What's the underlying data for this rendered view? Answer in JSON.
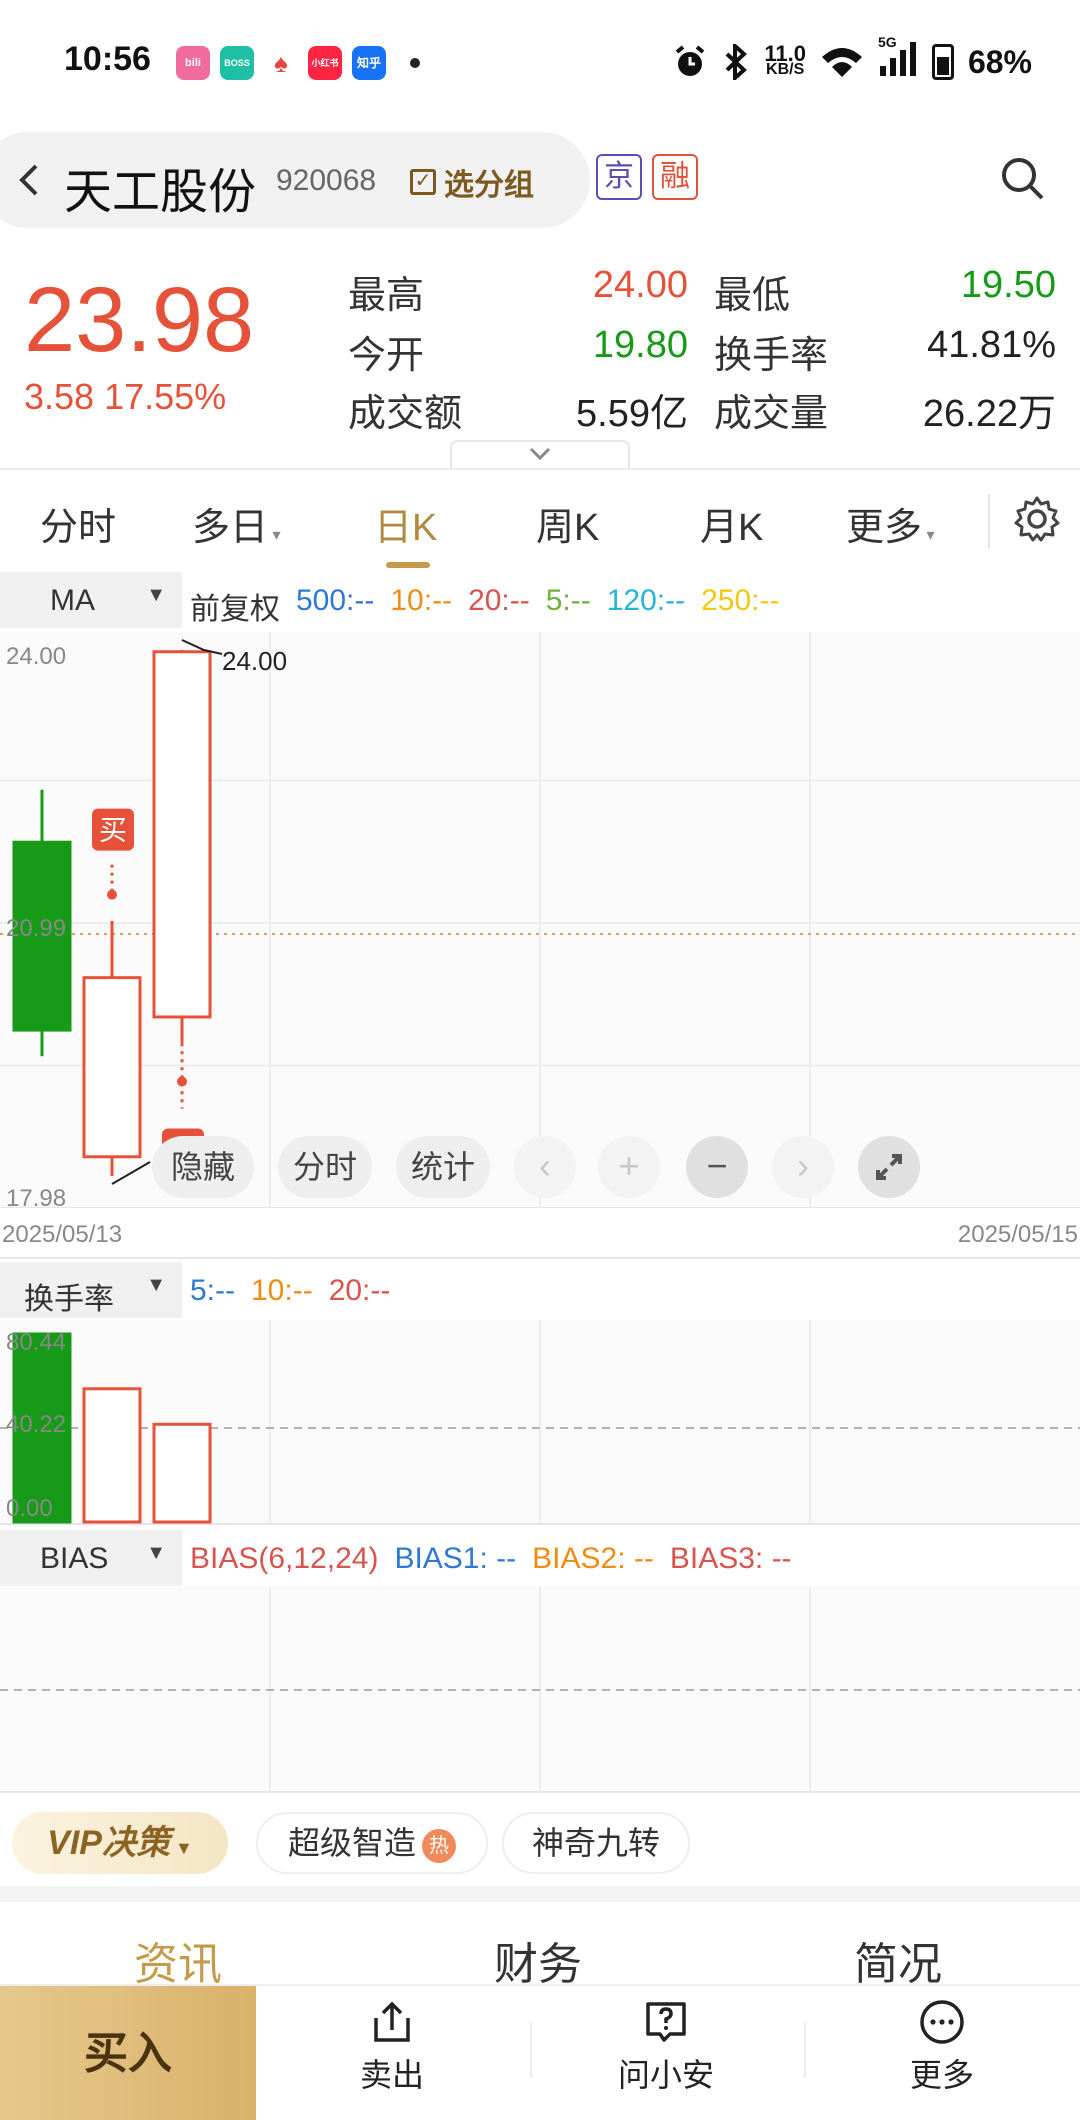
{
  "status_bar": {
    "time": "10:56",
    "apps": [
      {
        "name": "bilibili-app-icon",
        "label": "bili",
        "color": "#f06c9b"
      },
      {
        "name": "boss-app-icon",
        "label": "BOSS",
        "color": "#1fbfa5"
      },
      {
        "name": "card-app-icon",
        "label": "",
        "color": "#e8453c"
      },
      {
        "name": "xiaohongshu-app-icon",
        "label": "小红书",
        "color": "#ff2442"
      },
      {
        "name": "zhihu-app-icon",
        "label": "知乎",
        "color": "#1772f6"
      }
    ],
    "net_speed_value": "11.0",
    "net_speed_unit": "KB/S",
    "network": "5G",
    "battery": "68%"
  },
  "header": {
    "stock_name": "天工股份",
    "stock_code": "920068",
    "watch_label": "选分组",
    "tag_jing": "京",
    "tag_rong": "融"
  },
  "quote": {
    "price": "23.98",
    "change": "3.58 17.55%",
    "high_label": "最高",
    "high_value": "24.00",
    "low_label": "最低",
    "low_value": "19.50",
    "open_label": "今开",
    "open_value": "19.80",
    "turnover_rate_label": "换手率",
    "turnover_rate_value": "41.81%",
    "amount_label": "成交额",
    "amount_value": "5.59亿",
    "volume_label": "成交量",
    "volume_value": "26.22万",
    "colors": {
      "up": "#e55239",
      "down": "#169a17"
    }
  },
  "period_tabs": [
    {
      "label": "分时"
    },
    {
      "label": "多日"
    },
    {
      "label": "日K"
    },
    {
      "label": "周K"
    },
    {
      "label": "月K"
    },
    {
      "label": "更多"
    }
  ],
  "active_period": "日K",
  "main_chart": {
    "indicator": "MA",
    "adjust": "前复权",
    "legend": [
      {
        "text": "500:--",
        "color": "#2f79d6"
      },
      {
        "text": "10:--",
        "color": "#f08c14"
      },
      {
        "text": "20:--",
        "color": "#d9534f"
      },
      {
        "text": "5:--",
        "color": "#6cb33f"
      },
      {
        "text": "120:--",
        "color": "#25b5d6"
      },
      {
        "text": "250:--",
        "color": "#f2c811"
      }
    ],
    "y_top": "24.00",
    "y_mid": "20.99",
    "y_bottom": "17.98",
    "high_marker": "24.00",
    "low_marker": "17.98",
    "date_start": "2025/05/13",
    "date_end": "2025/05/15",
    "buy_mark": "买"
  },
  "chart_data": {
    "type": "candlestick",
    "y_range": [
      17.98,
      24.0
    ],
    "candles": [
      {
        "open": 21.8,
        "close": 19.65,
        "high": 22.4,
        "low": 19.35
      },
      {
        "open": 18.2,
        "close": 20.25,
        "high": 20.9,
        "low": 17.98
      },
      {
        "open": 19.8,
        "close": 23.98,
        "high": 24.0,
        "low": 19.5
      }
    ],
    "turnover": {
      "y_range": [
        0,
        80.44
      ],
      "values": [
        80.44,
        57.0,
        41.81
      ],
      "y_top": "80.44",
      "y_mid": "40.22",
      "y_bottom": "0.00"
    }
  },
  "overlay_buttons": {
    "hide": "隐藏",
    "intraday": "分时",
    "stats": "统计"
  },
  "turnover_panel": {
    "indicator": "换手率",
    "legend": [
      {
        "text": "5:--",
        "color": "#2f79d6"
      },
      {
        "text": "10:--",
        "color": "#f08c14"
      },
      {
        "text": "20:--",
        "color": "#d9534f"
      }
    ]
  },
  "bias_panel": {
    "indicator": "BIAS",
    "legend": [
      {
        "text": "BIAS(6,12,24)",
        "color": "#d9534f"
      },
      {
        "text": "BIAS1: --",
        "color": "#2f79d6"
      },
      {
        "text": "BIAS2: --",
        "color": "#f08c14"
      },
      {
        "text": "BIAS3: --",
        "color": "#d9534f"
      }
    ]
  },
  "strategy_bar": {
    "vip": "VIP决策",
    "smart": "超级智造",
    "hot": "热",
    "nine": "神奇九转"
  },
  "info_tabs": [
    {
      "label": "资讯"
    },
    {
      "label": "财务"
    },
    {
      "label": "简况"
    }
  ],
  "action_bar": {
    "buy": "买入",
    "sell": "卖出",
    "ask": "问小安",
    "more": "更多"
  }
}
